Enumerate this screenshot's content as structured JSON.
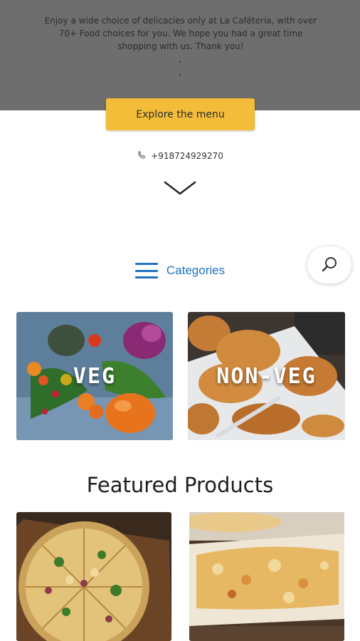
{
  "hero": {
    "intro_text": "Enjoy a wide choice of delicacies only at La Caféteria, with over 70+ Food choices for you. We hope you had a great time shopping with us. Thank you!",
    "explore_label": "Explore the menu",
    "phone": "+918724929270",
    "phone_icon": "phone-icon",
    "scroll_icon": "chevron-down-icon"
  },
  "categories": {
    "label": "Categories",
    "menu_icon": "hamburger-icon",
    "search_icon": "search-icon",
    "items": [
      {
        "label": "VEG"
      },
      {
        "label": "NON-VEG"
      }
    ]
  },
  "featured": {
    "title": "Featured Products"
  },
  "colors": {
    "accent": "#1e73be",
    "button": "#f3bd3a",
    "overlay": "#6e6e6e"
  }
}
